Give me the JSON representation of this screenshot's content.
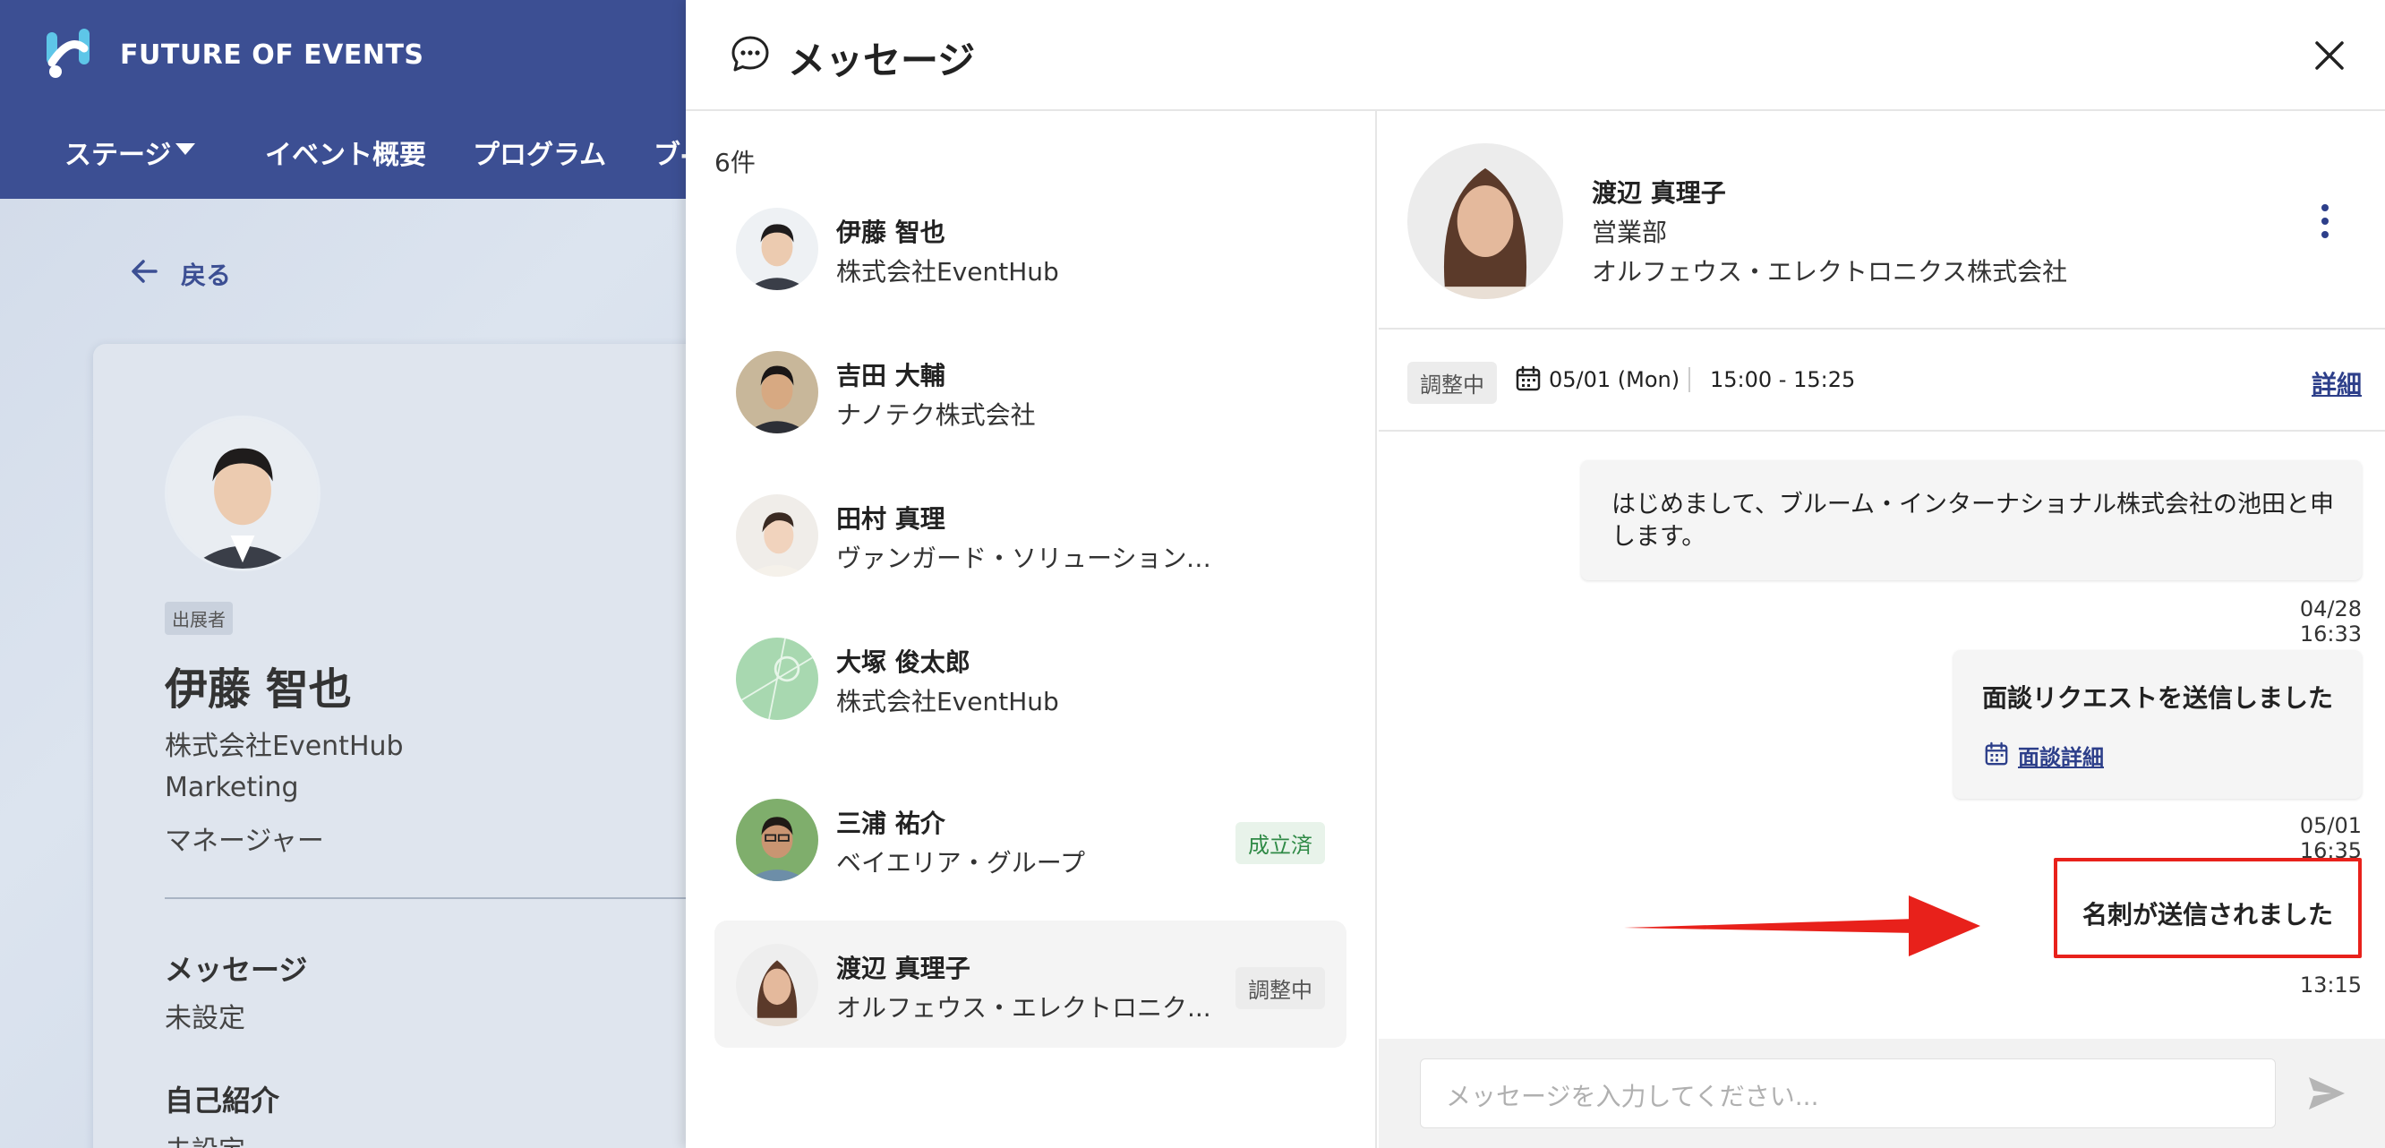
{
  "site": {
    "title": "FUTURE OF EVENTS",
    "nav": [
      "ステージ",
      "イベント概要",
      "プログラム",
      "ブ-"
    ]
  },
  "profile": {
    "back_label": "戻る",
    "badge": "出展者",
    "name": "伊藤 智也",
    "company": "株式会社EventHub",
    "department": "Marketing",
    "role": "マネージャー",
    "message_title": "メッセージ",
    "message_value": "未設定",
    "intro_title": "自己紹介",
    "intro_value": "未設定"
  },
  "panel": {
    "title": "メッセージ",
    "count": "6件",
    "conversations": [
      {
        "name": "伊藤 智也",
        "company": "株式会社EventHub",
        "badge": ""
      },
      {
        "name": "吉田 大輔",
        "company": "ナノテク株式会社",
        "badge": ""
      },
      {
        "name": "田村 真理",
        "company": "ヴァンガード・ソリューションズ合同会...",
        "badge": ""
      },
      {
        "name": "大塚 俊太郎",
        "company": "株式会社EventHub",
        "badge": ""
      },
      {
        "name": "三浦 祐介",
        "company": "ベイエリア・グループ",
        "badge": "成立済"
      },
      {
        "name": "渡辺 真理子",
        "company": "オルフェウス・エレクトロニク...",
        "badge": "調整中"
      }
    ]
  },
  "chat": {
    "contact": {
      "name": "渡辺 真理子",
      "department": "営業部",
      "company": "オルフェウス・エレクトロニクス株式会社"
    },
    "meeting": {
      "status": "調整中",
      "date": "05/01 (Mon)",
      "time": "15:00 - 15:25",
      "detail_label": "詳細"
    },
    "messages": [
      {
        "text": "はじめまして、ブルーム・インターナショナル株式会社の池田と申します。",
        "time": "04/28 16:33"
      },
      {
        "title": "面談リクエストを送信しました",
        "link": "面談詳細",
        "time": "05/01 16:35"
      },
      {
        "text": "名刺が送信されました",
        "time": "13:15"
      }
    ],
    "input_placeholder": "メッセージを入力してください..."
  },
  "colors": {
    "header_blue": "#3c4f93",
    "annotation_red": "#e8211b",
    "done_green": "#2f8a46"
  }
}
